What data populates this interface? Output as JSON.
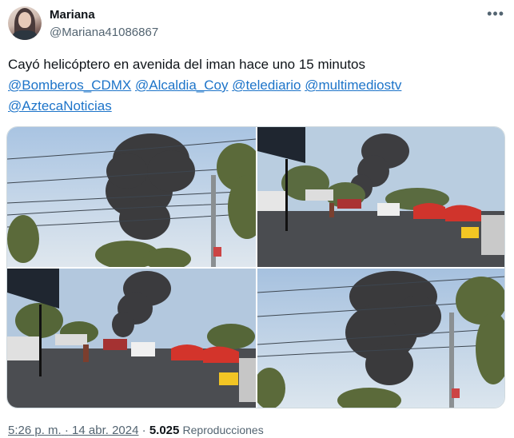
{
  "author": {
    "name": "Mariana",
    "handle": "@Mariana41086867"
  },
  "tweet": {
    "text": "Cayó helicóptero  en avenida del iman hace uno 15 minutos",
    "mentions": [
      "@Bomberos_CDMX",
      "@Alcaldia_Coy",
      "@telediario",
      "@multimediostv",
      "@AztecaNoticias"
    ]
  },
  "media": {
    "photos": [
      {
        "description_icon": "photo-smoke-closeup"
      },
      {
        "description_icon": "photo-street-stalls"
      },
      {
        "description_icon": "photo-street-stalls-wide"
      },
      {
        "description_icon": "photo-smoke-wires"
      }
    ]
  },
  "meta": {
    "time": "5:26 p. m.",
    "separator": "·",
    "date": "14 abr. 2024",
    "views_count": "5.025",
    "views_label": "Reproducciones"
  },
  "colors": {
    "link": "#1d74c9",
    "muted": "#536471",
    "text": "#0f1419",
    "border": "#cfd9de"
  },
  "icons": {
    "more": "more-dots-icon"
  }
}
